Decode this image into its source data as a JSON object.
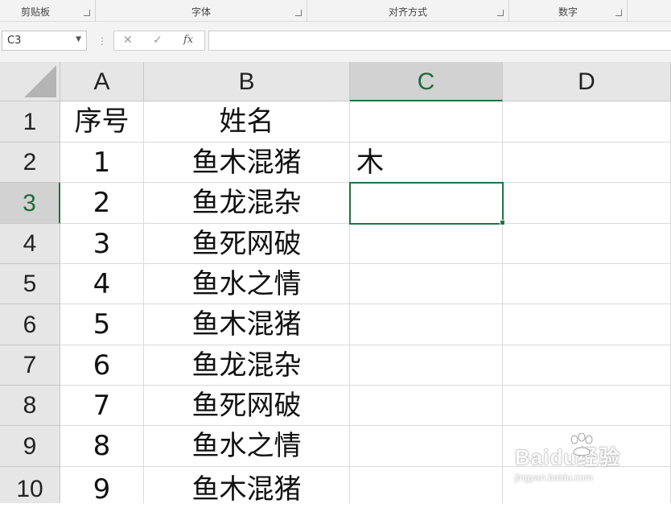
{
  "ribbon": {
    "groups": [
      {
        "label": "剪贴板"
      },
      {
        "label": "字体"
      },
      {
        "label": "对齐方式"
      },
      {
        "label": "数字"
      }
    ]
  },
  "formula_bar": {
    "name_box": "C3",
    "cancel_symbol": "✕",
    "enter_symbol": "✓",
    "fx_label": "fx",
    "formula_value": ""
  },
  "sheet": {
    "columns": [
      "A",
      "B",
      "C",
      "D"
    ],
    "rows": [
      "1",
      "2",
      "3",
      "4",
      "5",
      "6",
      "7",
      "8",
      "9",
      "10"
    ],
    "selected_cell": "C3",
    "cells": [
      [
        "序号",
        "姓名",
        "",
        ""
      ],
      [
        "1",
        "鱼木混猪",
        "木",
        ""
      ],
      [
        "2",
        "鱼龙混杂",
        "",
        ""
      ],
      [
        "3",
        "鱼死网破",
        "",
        ""
      ],
      [
        "4",
        "鱼水之情",
        "",
        ""
      ],
      [
        "5",
        "鱼木混猪",
        "",
        ""
      ],
      [
        "6",
        "鱼龙混杂",
        "",
        ""
      ],
      [
        "7",
        "鱼死网破",
        "",
        ""
      ],
      [
        "8",
        "鱼水之情",
        "",
        ""
      ],
      [
        "9",
        "鱼木混猪",
        "",
        ""
      ]
    ]
  },
  "watermark": {
    "brand": "Baidu经验",
    "url": "jingyan.baidu.com"
  },
  "colors": {
    "accent": "#217346",
    "header_bg": "#e6e6e6",
    "selected_header_bg": "#d2d2d2"
  }
}
